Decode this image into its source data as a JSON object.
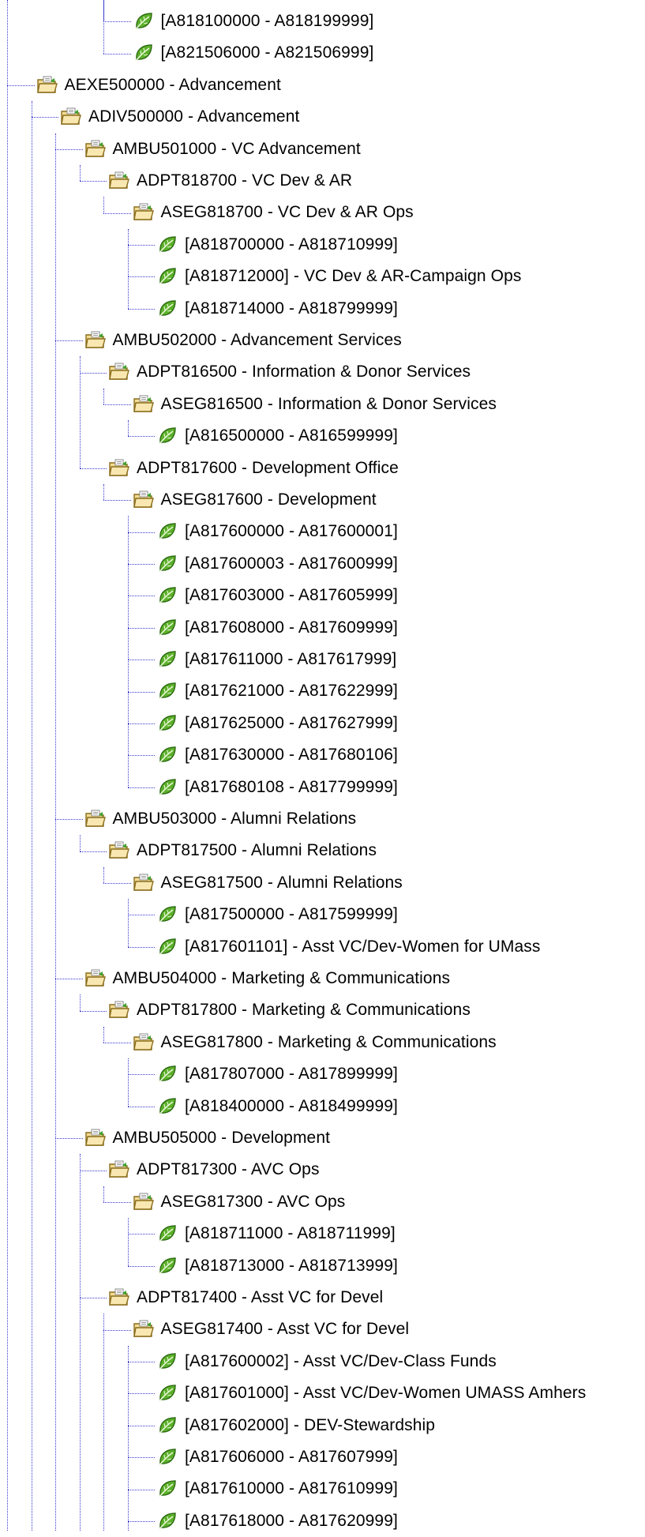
{
  "tree": {
    "items": [
      {
        "depth": 5,
        "kind": "leaf",
        "label": "[A818100000 - A818199999]"
      },
      {
        "depth": 5,
        "kind": "leaf",
        "label": "[A821506000 - A821506999]"
      },
      {
        "depth": 1,
        "kind": "folder",
        "label": "AEXE500000 - Advancement"
      },
      {
        "depth": 2,
        "kind": "folder",
        "label": "ADIV500000 - Advancement"
      },
      {
        "depth": 3,
        "kind": "folder",
        "label": "AMBU501000 - VC Advancement"
      },
      {
        "depth": 4,
        "kind": "folder",
        "label": "ADPT818700 - VC Dev & AR"
      },
      {
        "depth": 5,
        "kind": "folder",
        "label": "ASEG818700 - VC Dev & AR Ops"
      },
      {
        "depth": 6,
        "kind": "leaf",
        "label": "[A818700000 - A818710999]"
      },
      {
        "depth": 6,
        "kind": "leaf",
        "label": "[A818712000] - VC Dev & AR-Campaign Ops"
      },
      {
        "depth": 6,
        "kind": "leaf",
        "label": "[A818714000 - A818799999]"
      },
      {
        "depth": 3,
        "kind": "folder",
        "label": "AMBU502000 - Advancement Services"
      },
      {
        "depth": 4,
        "kind": "folder",
        "label": "ADPT816500 - Information & Donor Services"
      },
      {
        "depth": 5,
        "kind": "folder",
        "label": "ASEG816500 - Information & Donor Services"
      },
      {
        "depth": 6,
        "kind": "leaf",
        "label": "[A816500000 - A816599999]"
      },
      {
        "depth": 4,
        "kind": "folder",
        "label": "ADPT817600 - Development Office"
      },
      {
        "depth": 5,
        "kind": "folder",
        "label": "ASEG817600 - Development"
      },
      {
        "depth": 6,
        "kind": "leaf",
        "label": "[A817600000 - A817600001]"
      },
      {
        "depth": 6,
        "kind": "leaf",
        "label": "[A817600003 - A817600999]"
      },
      {
        "depth": 6,
        "kind": "leaf",
        "label": "[A817603000 - A817605999]"
      },
      {
        "depth": 6,
        "kind": "leaf",
        "label": "[A817608000 - A817609999]"
      },
      {
        "depth": 6,
        "kind": "leaf",
        "label": "[A817611000 - A817617999]"
      },
      {
        "depth": 6,
        "kind": "leaf",
        "label": "[A817621000 - A817622999]"
      },
      {
        "depth": 6,
        "kind": "leaf",
        "label": "[A817625000 - A817627999]"
      },
      {
        "depth": 6,
        "kind": "leaf",
        "label": "[A817630000 - A817680106]"
      },
      {
        "depth": 6,
        "kind": "leaf",
        "label": "[A817680108 - A817799999]"
      },
      {
        "depth": 3,
        "kind": "folder",
        "label": "AMBU503000 - Alumni Relations"
      },
      {
        "depth": 4,
        "kind": "folder",
        "label": "ADPT817500 - Alumni Relations"
      },
      {
        "depth": 5,
        "kind": "folder",
        "label": "ASEG817500 - Alumni Relations"
      },
      {
        "depth": 6,
        "kind": "leaf",
        "label": "[A817500000 - A817599999]"
      },
      {
        "depth": 6,
        "kind": "leaf",
        "label": "[A817601101] - Asst VC/Dev-Women for UMass"
      },
      {
        "depth": 3,
        "kind": "folder",
        "label": "AMBU504000 - Marketing & Communications"
      },
      {
        "depth": 4,
        "kind": "folder",
        "label": "ADPT817800 - Marketing & Communications"
      },
      {
        "depth": 5,
        "kind": "folder",
        "label": "ASEG817800 - Marketing & Communications"
      },
      {
        "depth": 6,
        "kind": "leaf",
        "label": "[A817807000 - A817899999]"
      },
      {
        "depth": 6,
        "kind": "leaf",
        "label": "[A818400000 - A818499999]"
      },
      {
        "depth": 3,
        "kind": "folder",
        "label": "AMBU505000 - Development"
      },
      {
        "depth": 4,
        "kind": "folder",
        "label": "ADPT817300 - AVC Ops"
      },
      {
        "depth": 5,
        "kind": "folder",
        "label": "ASEG817300 - AVC Ops"
      },
      {
        "depth": 6,
        "kind": "leaf",
        "label": "[A818711000 - A818711999]"
      },
      {
        "depth": 6,
        "kind": "leaf",
        "label": "[A818713000 - A818713999]"
      },
      {
        "depth": 4,
        "kind": "folder",
        "label": "ADPT817400 - Asst VC for Devel"
      },
      {
        "depth": 5,
        "kind": "folder",
        "label": "ASEG817400 - Asst VC for Devel"
      },
      {
        "depth": 6,
        "kind": "leaf",
        "label": "[A817600002] - Asst VC/Dev-Class Funds"
      },
      {
        "depth": 6,
        "kind": "leaf",
        "label": "[A817601000] - Asst VC/Dev-Women UMASS Amhers"
      },
      {
        "depth": 6,
        "kind": "leaf",
        "label": "[A817602000] - DEV-Stewardship"
      },
      {
        "depth": 6,
        "kind": "leaf",
        "label": "[A817606000 - A817607999]"
      },
      {
        "depth": 6,
        "kind": "leaf",
        "label": "[A817610000 - A817610999]"
      },
      {
        "depth": 6,
        "kind": "leaf",
        "label": "[A817618000 - A817620999]"
      }
    ]
  },
  "icons": {
    "folder": "open-folder-icon",
    "leaf": "green-leaf-icon"
  },
  "colors": {
    "connector": "#3a3ad0",
    "folder_fill": "#f3dc94",
    "folder_edge": "#8a6d1c",
    "leaf_fill": "#5cb02a",
    "leaf_edge": "#2c6a12"
  }
}
